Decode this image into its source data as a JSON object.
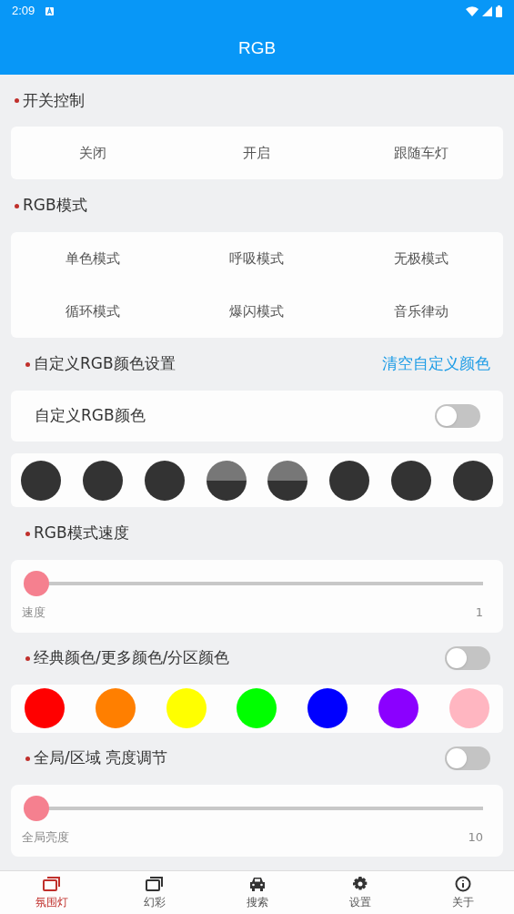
{
  "status_bar": {
    "time": "2:09"
  },
  "title": "RGB",
  "switch_section": {
    "heading": "开关控制",
    "options": [
      "关闭",
      "开启",
      "跟随车灯"
    ]
  },
  "mode_section": {
    "heading": "RGB模式",
    "options": [
      "单色模式",
      "呼吸模式",
      "无极模式",
      "循环模式",
      "爆闪模式",
      "音乐律动"
    ]
  },
  "custom_section": {
    "heading": "自定义RGB颜色设置",
    "link": "清空自定义颜色",
    "toggle": {
      "label": "自定义RGB颜色",
      "on": false
    },
    "swatches": [
      {
        "color": "#333333",
        "kind": "solid"
      },
      {
        "color": "#333333",
        "kind": "solid"
      },
      {
        "color": "#333333",
        "kind": "solid"
      },
      {
        "color": "#333333",
        "kind": "shaded"
      },
      {
        "color": "#333333",
        "kind": "shaded"
      },
      {
        "color": "#333333",
        "kind": "solid"
      },
      {
        "color": "#333333",
        "kind": "solid"
      },
      {
        "color": "#333333",
        "kind": "solid"
      }
    ]
  },
  "speed_section": {
    "heading": "RGB模式速度",
    "slider": {
      "label": "速度",
      "value": "1",
      "level": 0
    }
  },
  "classic_section": {
    "heading": "经典颜色/更多颜色/分区颜色",
    "on": false,
    "swatches": [
      {
        "color": "#ff0000"
      },
      {
        "color": "#ff7f00"
      },
      {
        "color": "#ffff00"
      },
      {
        "color": "#00ff00"
      },
      {
        "color": "#0000ff"
      },
      {
        "color": "#8b00ff"
      },
      {
        "color": "#ffb6c1"
      }
    ]
  },
  "brightness_section": {
    "heading": "全局/区域 亮度调节",
    "on": false,
    "slider": {
      "label": "全局亮度",
      "value": "10",
      "level": 0
    }
  },
  "bottom_nav": [
    {
      "label": "氛围灯",
      "kind": "windows",
      "selected": true
    },
    {
      "label": "幻彩",
      "kind": "windows",
      "selected": false
    },
    {
      "label": "搜索",
      "kind": "car",
      "selected": false
    },
    {
      "label": "设置",
      "kind": "gear",
      "selected": false
    },
    {
      "label": "关于",
      "kind": "info",
      "selected": false
    }
  ]
}
